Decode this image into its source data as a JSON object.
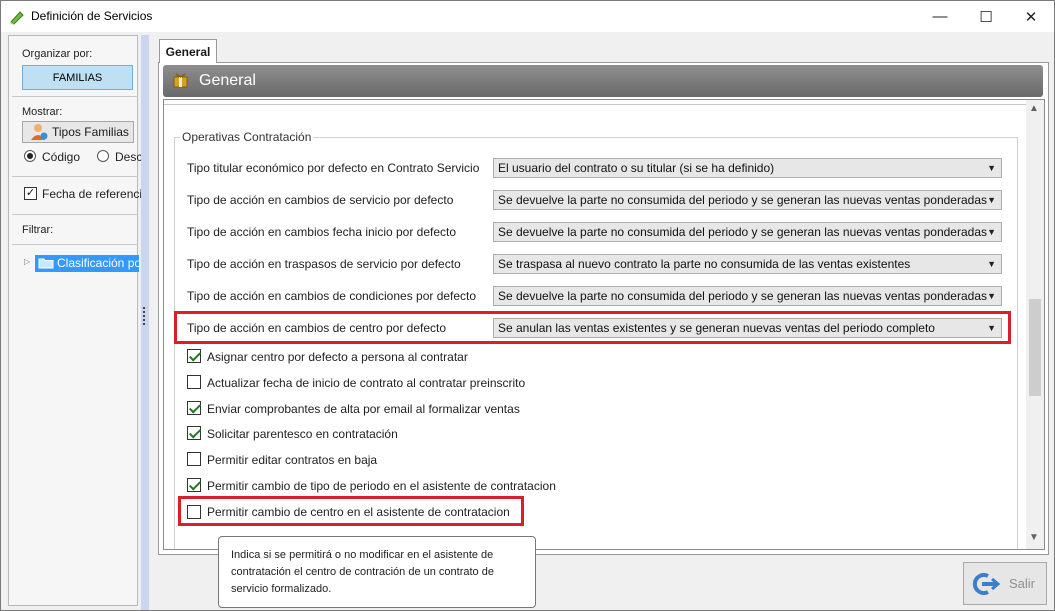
{
  "window": {
    "title": "Definición de Servicios",
    "controls": {
      "minimize": "—",
      "maximize": "☐",
      "close": "✕"
    }
  },
  "left": {
    "organizar_label": "Organizar por:",
    "organizar_button": "FAMILIAS",
    "mostrar_label": "Mostrar:",
    "tipos_button": "Tipos Familias",
    "radio_codigo": "Código",
    "radio_desc": "Desc",
    "fecha_label": "Fecha de referencia",
    "filtrar_label": "Filtrar:",
    "tree_item": "Clasificación por"
  },
  "tab": {
    "label": "General"
  },
  "header": {
    "title": "General"
  },
  "group": {
    "title": "Operativas Contratación"
  },
  "fields": [
    {
      "label": "Tipo titular económico por defecto en Contrato Servicio",
      "value": "El usuario del contrato o su titular (si se ha definido)"
    },
    {
      "label": "Tipo de acción en cambios de servicio por defecto",
      "value": "Se devuelve la parte no consumida del periodo y se generan las nuevas ventas ponderadas"
    },
    {
      "label": "Tipo de acción en cambios fecha inicio por defecto",
      "value": "Se devuelve la parte no consumida del periodo y se generan las nuevas ventas ponderadas"
    },
    {
      "label": "Tipo de acción en traspasos de servicio por defecto",
      "value": "Se traspasa al nuevo contrato la parte no consumida de las ventas existentes"
    },
    {
      "label": "Tipo de acción en cambios de condiciones por defecto",
      "value": "Se devuelve la parte no consumida del periodo y se generan las nuevas ventas ponderadas"
    },
    {
      "label": "Tipo de acción en cambios de centro por defecto",
      "value": "Se anulan las ventas existentes y se generan nuevas ventas del periodo completo"
    }
  ],
  "checkboxes": [
    {
      "label": "Asignar centro por defecto a persona al contratar",
      "checked": true
    },
    {
      "label": "Actualizar fecha de inicio de contrato al contratar preinscrito",
      "checked": false
    },
    {
      "label": "Enviar comprobantes de alta por email al formalizar ventas",
      "checked": true
    },
    {
      "label": "Solicitar parentesco en contratación",
      "checked": true
    },
    {
      "label": "Permitir editar contratos en baja",
      "checked": false
    },
    {
      "label": "Permitir cambio de tipo de periodo en el asistente de contratacion",
      "checked": true
    },
    {
      "label": "Permitir cambio de centro en el asistente de contratacion",
      "checked": false
    }
  ],
  "tooltip": {
    "text": "Indica si se permitirá o no modificar en el asistente de contratación el centro de contración de un contrato de servicio formalizado."
  },
  "footer": {
    "salir": "Salir"
  },
  "colors": {
    "highlight_red": "#d9202a",
    "header_gray": "#7a7a7a",
    "check_green": "#1e7a1e",
    "selection_blue": "#3399ff"
  },
  "icons": [
    "pencil-icon",
    "user-icon",
    "folder-icon",
    "gift-icon",
    "exit-icon"
  ]
}
